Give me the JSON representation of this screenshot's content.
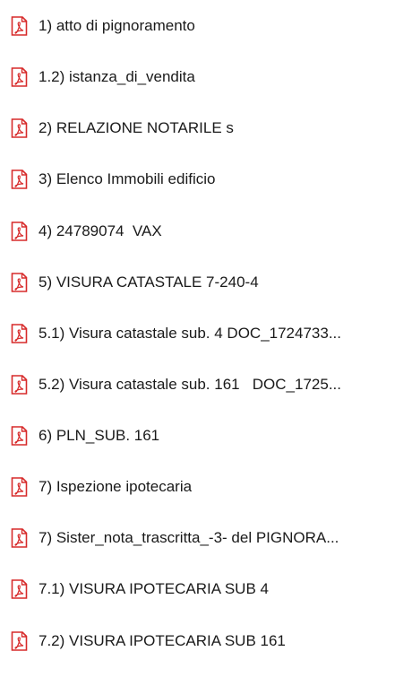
{
  "icon": "pdf-file-icon",
  "colors": {
    "icon_red": "#d72b2b",
    "icon_page": "#ffffff",
    "text": "#1a1a1a"
  },
  "files": [
    {
      "name": "1) atto di pignoramento"
    },
    {
      "name": "1.2) istanza_di_vendita"
    },
    {
      "name": "2) RELAZIONE NOTARILE s"
    },
    {
      "name": "3) Elenco Immobili edificio"
    },
    {
      "name": "4) 24789074  VAX"
    },
    {
      "name": "5) VISURA CATASTALE 7-240-4"
    },
    {
      "name": "5.1) Visura catastale sub. 4 DOC_1724733..."
    },
    {
      "name": "5.2) Visura catastale sub. 161   DOC_1725..."
    },
    {
      "name": "6) PLN_SUB. 161"
    },
    {
      "name": "7) Ispezione ipotecaria"
    },
    {
      "name": "7) Sister_nota_trascritta_-3- del PIGNORA..."
    },
    {
      "name": "7.1) VISURA IPOTECARIA SUB 4"
    },
    {
      "name": "7.2) VISURA IPOTECARIA SUB 161"
    }
  ]
}
